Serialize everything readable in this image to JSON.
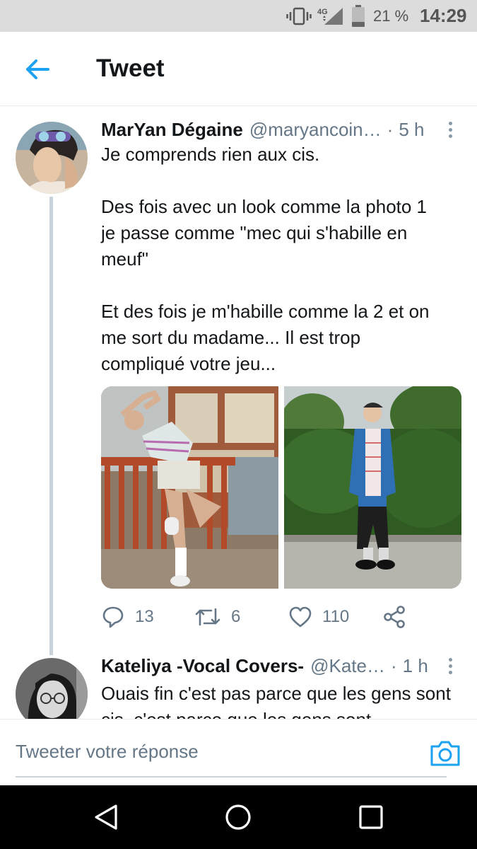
{
  "status_bar": {
    "network": "4G",
    "battery": "21 %",
    "time": "14:29",
    "icons": [
      "vibrate-icon",
      "signal-icon",
      "battery-icon"
    ]
  },
  "header": {
    "title": "Tweet",
    "back_icon": "arrow-left-icon",
    "accent_color": "#1da1f2"
  },
  "tweet": {
    "name": "MarYan Dégaine",
    "handle": "@maryancoin…",
    "separator": "·",
    "time": "5 h",
    "text": "Je comprends rien aux cis.\n\nDes fois avec un look comme la photo 1\nje passe comme  \"mec qui s'habille en\nmeuf\"\n\nEt des fois je m'habille comme la 2 et on\nme sort du madame... Il est trop\ncompliqué votre jeu...",
    "media": [
      "photo-1",
      "photo-2"
    ],
    "actions": {
      "replies": "13",
      "retweets": "6",
      "likes": "110"
    }
  },
  "reply": {
    "name": "Kateliya -Vocal Covers-",
    "handle": "@Kate…",
    "separator": "·",
    "time": "1 h",
    "text": "Ouais fin c'est pas parce que les gens sont cis, c'est parce que les gens sont"
  },
  "compose": {
    "placeholder": "Tweeter votre réponse",
    "camera_icon": "camera-icon"
  },
  "nav": {
    "icons": [
      "back-triangle-icon",
      "home-circle-icon",
      "recents-square-icon"
    ]
  }
}
